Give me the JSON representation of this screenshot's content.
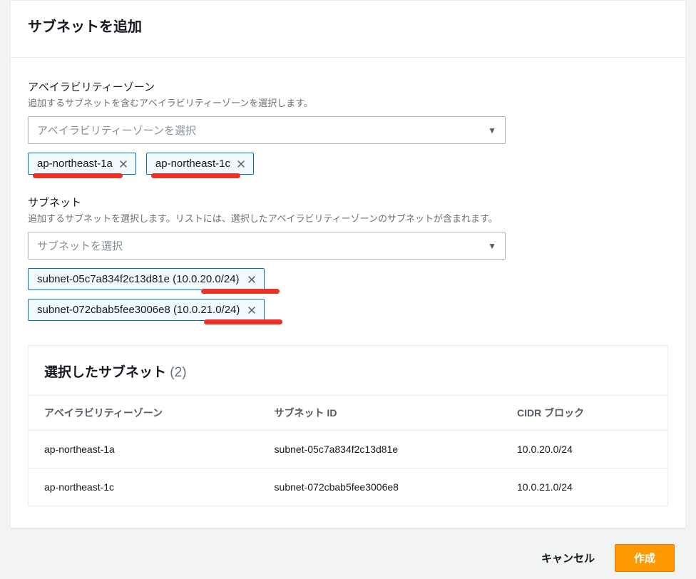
{
  "panel": {
    "title": "サブネットを追加"
  },
  "az": {
    "label": "アベイラビリティーゾーン",
    "desc": "追加するサブネットを含むアベイラビリティーゾーンを選択します。",
    "placeholder": "アベイラビリティーゾーンを選択",
    "selected": [
      "ap-northeast-1a",
      "ap-northeast-1c"
    ]
  },
  "subnet": {
    "label": "サブネット",
    "desc": "追加するサブネットを選択します。リストには、選択したアベイラビリティーゾーンのサブネットが含まれます。",
    "placeholder": "サブネットを選択",
    "selected": [
      "subnet-05c7a834f2c13d81e (10.0.20.0/24)",
      "subnet-072cbab5fee3006e8 (10.0.21.0/24)"
    ]
  },
  "table": {
    "title": "選択したサブネット",
    "count": "(2)",
    "headers": {
      "az": "アベイラビリティーゾーン",
      "subnet_id": "サブネット ID",
      "cidr": "CIDR ブロック"
    },
    "rows": [
      {
        "az": "ap-northeast-1a",
        "subnet_id": "subnet-05c7a834f2c13d81e",
        "cidr": "10.0.20.0/24"
      },
      {
        "az": "ap-northeast-1c",
        "subnet_id": "subnet-072cbab5fee3006e8",
        "cidr": "10.0.21.0/24"
      }
    ]
  },
  "footer": {
    "cancel": "キャンセル",
    "create": "作成"
  }
}
